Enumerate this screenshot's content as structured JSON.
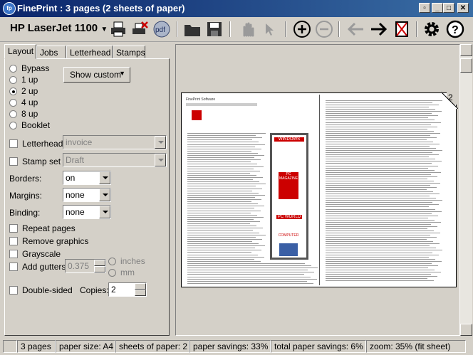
{
  "window": {
    "title": "FinePrint : 3 pages (2 sheets of paper)",
    "app_icon": "fp"
  },
  "toolbar": {
    "printer": "HP LaserJet 1100"
  },
  "tabs": [
    "Layout",
    "Jobs",
    "Letterhead",
    "Stamps"
  ],
  "layout": {
    "options": [
      "Bypass",
      "1 up",
      "2 up",
      "4 up",
      "8 up",
      "Booklet"
    ],
    "selected": "2 up",
    "show_custom": "Show custom",
    "letterhead_label": "Letterhead",
    "letterhead_value": "invoice",
    "stampset_label": "Stamp set",
    "stampset_value": "Draft",
    "borders_label": "Borders:",
    "borders_value": "on",
    "margins_label": "Margins:",
    "margins_value": "none",
    "binding_label": "Binding:",
    "binding_value": "none",
    "repeat_pages": "Repeat pages",
    "remove_graphics": "Remove graphics",
    "grayscale": "Grayscale",
    "add_gutters": "Add gutters",
    "gutter_value": "0.375",
    "inches": "inches",
    "mm": "mm",
    "double_sided": "Double-sided",
    "copies_label": "Copies:",
    "copies_value": "2"
  },
  "preview": {
    "page_number": "2",
    "sidebar_title": "FinePrint Software",
    "sidebar_brands": [
      "WINDOWS",
      "PC MAGAZINE",
      "PC WORLD",
      "COMPUTER"
    ]
  },
  "status": [
    "3 pages",
    "paper size: A4",
    "sheets of paper: 2",
    "paper savings: 33%",
    "total paper savings: 6%",
    "zoom: 35% (fit sheet)"
  ]
}
